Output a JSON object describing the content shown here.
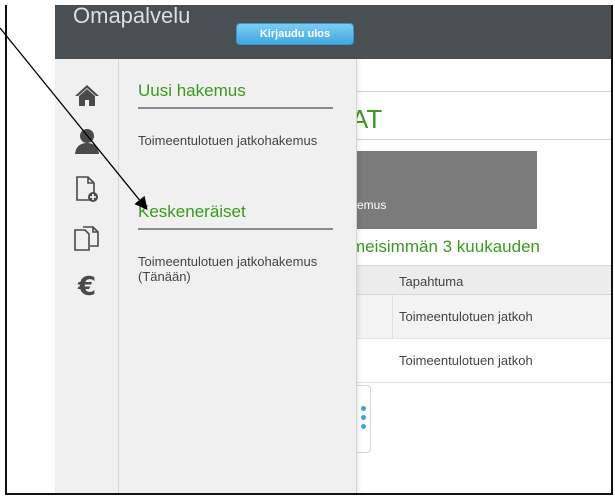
{
  "header": {
    "app_title": "Omapalvelu",
    "logout_label": "Kirjaudu ulos"
  },
  "rail": {
    "icons": [
      "home-icon",
      "user-icon",
      "new-document-icon",
      "documents-icon",
      "euro-icon"
    ]
  },
  "drawer": {
    "sections": [
      {
        "title": "Uusi hakemus",
        "items": [
          "Toimeentulotuen jatkohakemus"
        ]
      },
      {
        "title": "Keskeneräiset",
        "items": [
          "Toimeentulotuen jatkohakemus (Tänään)"
        ]
      }
    ]
  },
  "page": {
    "heading_fragment": "AT",
    "card_label_fragment": "kemus",
    "section_fragment": "meisimmän 3 kuukauden",
    "table": {
      "header": "Tapahtuma",
      "rows": [
        "Toimeentulotuen jatkoh",
        "Toimeentulotuen jatkoh"
      ]
    }
  },
  "colors": {
    "accent_green": "#3a9a1e",
    "header_bg": "#4a4f53",
    "button_blue": "#3ea9e2"
  }
}
